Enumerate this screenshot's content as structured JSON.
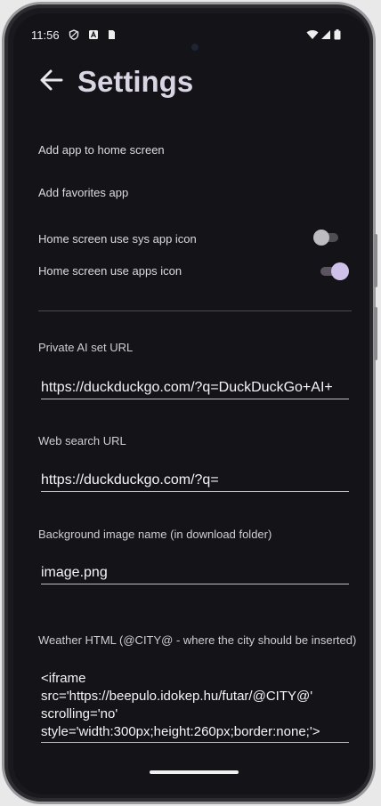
{
  "status_bar": {
    "time": "11:56",
    "left_icons": [
      "shield-icon",
      "a-badge-icon",
      "sim-card-icon"
    ],
    "right_icons": [
      "wifi-icon",
      "signal-icon",
      "battery-icon"
    ]
  },
  "app_bar": {
    "title": "Settings"
  },
  "settings": {
    "add_home": "Add app to home screen",
    "add_favorites": "Add favorites app",
    "sys_icon_label": "Home screen use sys app icon",
    "sys_icon_on": false,
    "apps_icon_label": "Home screen use apps icon",
    "apps_icon_on": true
  },
  "fields": {
    "ai_url_label": "Private AI set URL",
    "ai_url_value": "https://duckduckgo.com/?q=DuckDuckGo+AI+",
    "web_search_label": "Web search URL",
    "web_search_value": "https://duckduckgo.com/?q=",
    "bg_image_label": "Background image name (in download folder)",
    "bg_image_value": "image.png",
    "weather_label": "Weather HTML (@CITY@ - where the city should be inserted)",
    "weather_value": "<iframe src='https://beepulo.idokep.hu/futar/@CITY@' scrolling='no' style='width:300px;height:260px;border:none;'>"
  },
  "colors": {
    "background": "#141317",
    "accent": "#cfc2ea",
    "text": "#dcdce0"
  }
}
